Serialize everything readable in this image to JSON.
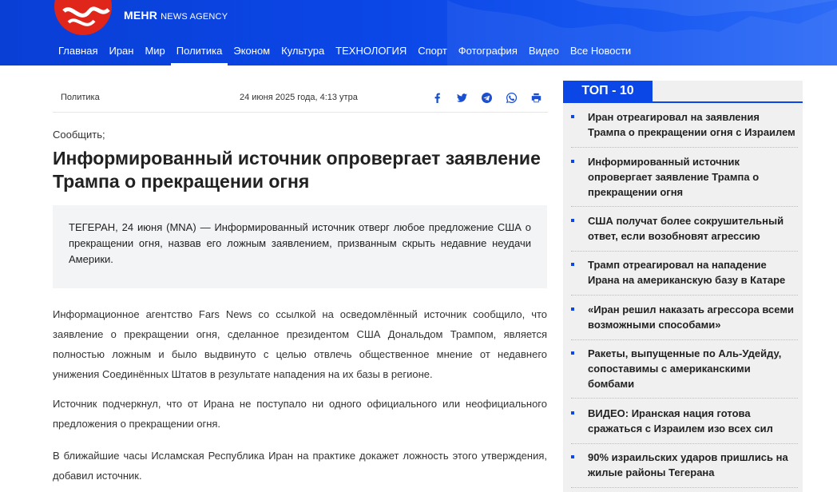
{
  "header": {
    "brand_main": "MEHR",
    "brand_sub": "NEWS AGENCY",
    "nav": [
      {
        "label": "Главная"
      },
      {
        "label": "Иран"
      },
      {
        "label": "Мир"
      },
      {
        "label": "Политика"
      },
      {
        "label": "Эконом"
      },
      {
        "label": "Культура"
      },
      {
        "label": "ТЕХНОЛОГИЯ"
      },
      {
        "label": "Спорт"
      },
      {
        "label": "Фотография"
      },
      {
        "label": "Видео"
      },
      {
        "label": "Все Новости"
      }
    ],
    "active_nav": "Политика",
    "color": "#0b46e6"
  },
  "article": {
    "category": "Политика",
    "date": "24 июня 2025 года, 4:13 утра",
    "share_icons": [
      "facebook-icon",
      "twitter-icon",
      "telegram-icon",
      "whatsapp-icon",
      "print-icon"
    ],
    "kicker": "Сообщить;",
    "title": "Информированный источник опровергает заявление Трампа о прекращении огня",
    "lead": "ТЕГЕРАН, 24 июня (MNA) — Информированный источник отверг любое предложение США о прекращении огня, назвав его ложным заявлением, призванным скрыть недавние неудачи Америки.",
    "paragraphs": [
      "Информационное агентство Fars News со ссылкой на осведомлённый источник сообщило, что заявление о прекращении огня, сделанное президентом США Дональдом Трампом, является полностью ложным и было выдвинуто с целью отвлечь общественное мнение от недавнего унижения Соединённых Штатов в результате нападения на их базы в регионе.",
      "Источник подчеркнул, что от Ирана не поступало ни одного официального или неофициального предложения о прекращении огня.",
      "В ближайшие часы Исламская Республика Иран на практике докажет ложность этого утверждения, добавил источник."
    ]
  },
  "sidebar": {
    "badge": "ТОП - 10",
    "items": [
      {
        "title": "Иран отреагировал на заявления Трампа о прекращении огня с Израилем"
      },
      {
        "title": "Информированный источник опровергает заявление Трампа о прекращении огня"
      },
      {
        "title": "США получат более сокрушительный ответ, если возобновят агрессию"
      },
      {
        "title": "Трамп отреагировал на нападение Ирана на американскую базу в Катаре"
      },
      {
        "title": "«Иран решил наказать агрессора всеми возможными способами»"
      },
      {
        "title": "Ракеты, выпущенные по Аль-Удейду, сопоставимы с американскими бомбами"
      },
      {
        "title": "ВИДЕО: Иранская нация готова сражаться с Израилем изо всех сил"
      },
      {
        "title": "90% израильских ударов пришлись на жилые районы Тегерана"
      }
    ]
  }
}
